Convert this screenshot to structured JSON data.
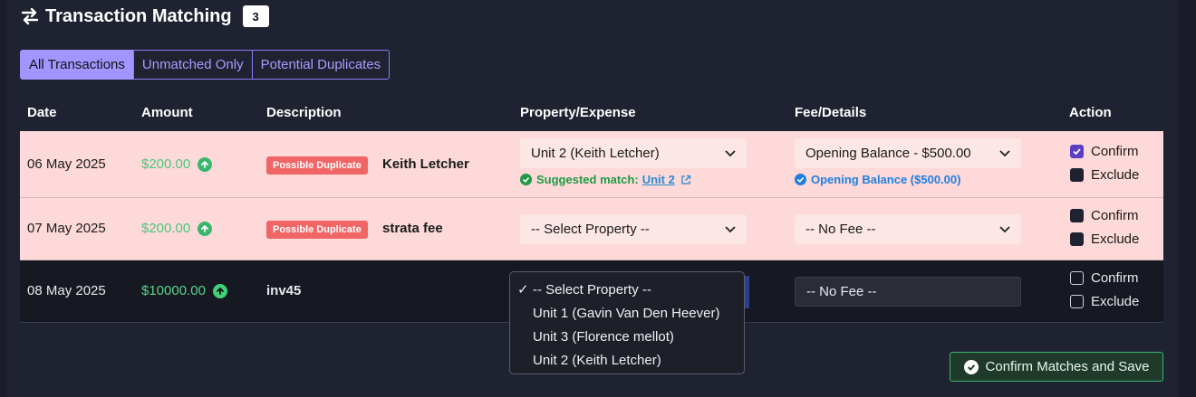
{
  "header": {
    "title": "Transaction Matching",
    "count": "3",
    "icon": "swap-icon"
  },
  "tabs": [
    {
      "label": "All Transactions",
      "active": true
    },
    {
      "label": "Unmatched Only",
      "active": false
    },
    {
      "label": "Potential Duplicates",
      "active": false
    }
  ],
  "columns": {
    "date": "Date",
    "amount": "Amount",
    "description": "Description",
    "property": "Property/Expense",
    "fee": "Fee/Details",
    "action": "Action"
  },
  "rows": [
    {
      "date": "06 May 2025",
      "amount": "$200.00",
      "badge": "Possible Duplicate",
      "description": "Keith Letcher",
      "property": "Unit 2 (Keith Letcher)",
      "suggest_label": "Suggested match:",
      "suggest_link": "Unit 2",
      "fee": "Opening Balance - $500.00",
      "fee_note": "Opening Balance ($500.00)",
      "confirm": "Confirm",
      "exclude": "Exclude",
      "confirm_checked": true,
      "exclude_checked": false
    },
    {
      "date": "07 May 2025",
      "amount": "$200.00",
      "badge": "Possible Duplicate",
      "description": "strata fee",
      "property": "-- Select Property --",
      "fee": "-- No Fee --",
      "confirm": "Confirm",
      "exclude": "Exclude",
      "confirm_checked": false,
      "exclude_checked": false
    },
    {
      "date": "08 May 2025",
      "amount": "$10000.00",
      "description": "inv45",
      "fee": "-- No Fee --",
      "confirm": "Confirm",
      "exclude": "Exclude",
      "confirm_checked": false,
      "exclude_checked": false
    }
  ],
  "dropdown": {
    "options": [
      "-- Select Property --",
      "Unit 1 (Gavin Van Den Heever)",
      "Unit 3 (Florence mellot)",
      "Unit 2 (Keith Letcher)"
    ],
    "selected": "-- Select Property --"
  },
  "save_button": {
    "label": "Confirm Matches and Save"
  },
  "colors": {
    "accent": "#a395ff",
    "duplicate_row": "#fdd9d9",
    "badge": "#f06565",
    "positive": "#5bd38a",
    "save_border": "#3bb36c"
  }
}
